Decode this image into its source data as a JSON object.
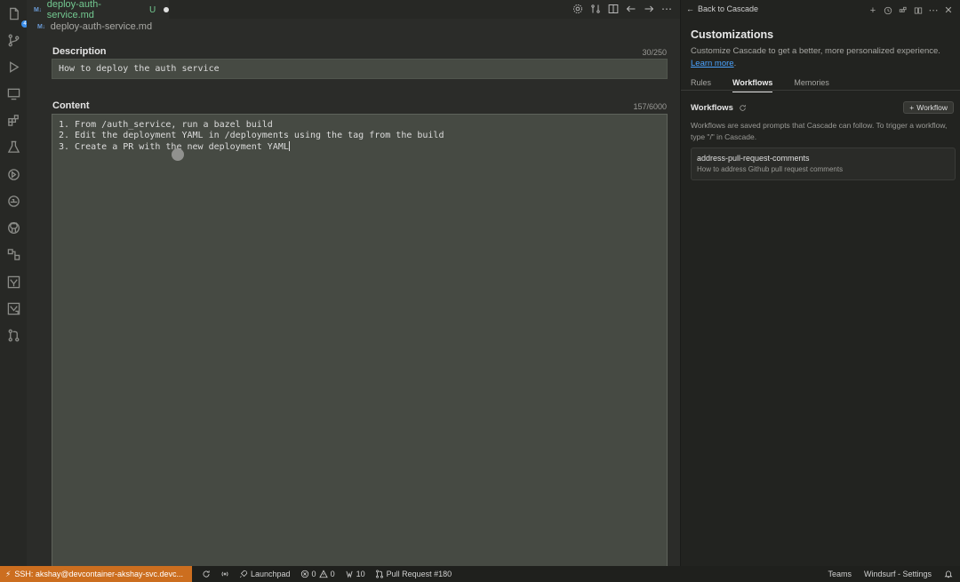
{
  "activity_bar": {
    "items": [
      {
        "icon": "files-icon",
        "badge": "4"
      },
      {
        "icon": "source-control-icon"
      },
      {
        "icon": "run-debug-icon"
      },
      {
        "icon": "remote-explorer-icon"
      },
      {
        "icon": "extensions-icon"
      },
      {
        "icon": "testing-icon"
      },
      {
        "icon": "deploy-icon"
      },
      {
        "icon": "docker-icon"
      },
      {
        "icon": "github-icon"
      },
      {
        "icon": "diagram-icon"
      },
      {
        "icon": "kubernetes-icon"
      },
      {
        "icon": "kubernetes-alt-icon"
      },
      {
        "icon": "pull-requests-icon"
      }
    ]
  },
  "editor": {
    "tab": {
      "icon": "M↓",
      "title": "deploy-auth-service.md",
      "status": "U"
    },
    "breadcrumb": {
      "icon": "M↓",
      "text": "deploy-auth-service.md"
    },
    "description": {
      "label": "Description",
      "count": "30/250",
      "value": "How to deploy the auth service"
    },
    "content": {
      "label": "Content",
      "count": "157/6000",
      "lines": [
        "1. From /auth_service, run a bazel build",
        "2. Edit the deployment YAML in /deployments using the tag from the build",
        "3. Create a PR with the new deployment YAML"
      ]
    }
  },
  "panel": {
    "back_label": "Back to Cascade",
    "title": "Customizations",
    "subtitle": "Customize Cascade to get a better, more personalized experience.",
    "learn_more": "Learn more",
    "tabs": [
      {
        "label": "Rules",
        "active": false
      },
      {
        "label": "Workflows",
        "active": true
      },
      {
        "label": "Memories",
        "active": false
      }
    ],
    "workflows": {
      "heading": "Workflows",
      "add_label": "Workflow",
      "description": "Workflows are saved prompts that Cascade can follow. To trigger a workflow, type \"/\" in Cascade.",
      "items": [
        {
          "name": "address-pull-request-comments",
          "desc": "How to address Github pull request comments"
        }
      ]
    }
  },
  "statusbar": {
    "remote": "SSH: akshay@devcontainer-akshay-svc.devc...",
    "launchpad": "Launchpad",
    "errors": "0",
    "warnings": "0",
    "ports": "10",
    "pull_request": "Pull Request #180",
    "teams": "Teams",
    "settings": "Windsurf - Settings"
  },
  "colors": {
    "accent": "#cc6e1f",
    "link": "#4aa3ff",
    "modified": "#73c991"
  }
}
